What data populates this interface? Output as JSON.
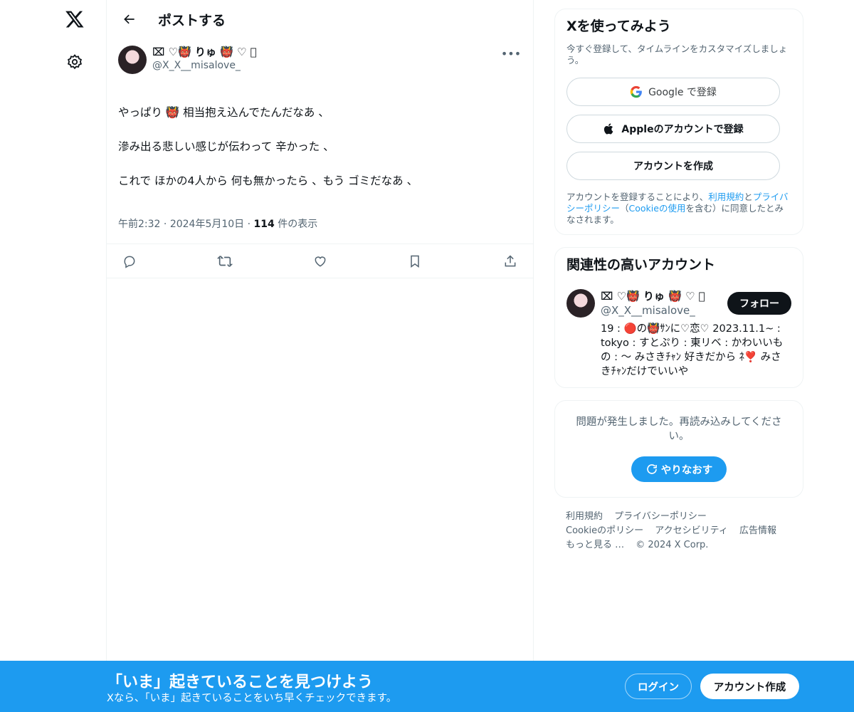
{
  "nav": {
    "logo_icon": "x-logo-icon",
    "settings_icon": "gear-icon"
  },
  "header": {
    "title": "ポストする"
  },
  "post": {
    "author_name": "⌧ ♡👹 りゅ 👹 ♡ ⃞",
    "author_handle": "@X_X__misalove_",
    "text_line1": "やっぱり 👹 相当抱え込んでたんだなあ 、",
    "text_line2": "滲み出る悲しい感じが伝わって 辛かった 、",
    "text_line3": "これで ほかの4人から 何も無かったら 、もう ゴミだなあ 、",
    "time": "午前2:32",
    "date": "2024年5月10日",
    "views_count": "114",
    "views_label": "件の表示"
  },
  "signup": {
    "title": "Xを使ってみよう",
    "subtitle": "今すぐ登録して、タイムラインをカスタマイズしましょう。",
    "google_label": "Google で登録",
    "apple_label": "Appleのアカウントで登録",
    "create_label": "アカウントを作成",
    "terms_pre": "アカウントを登録することにより、",
    "terms_link1": "利用規約",
    "terms_and": "と",
    "terms_link2": "プライバシーポリシー",
    "terms_mid": "（",
    "terms_link3": "Cookieの使用",
    "terms_post": "を含む）に同意したとみなされます。"
  },
  "related": {
    "title": "関連性の高いアカウント",
    "name": "⌧ ♡👹 りゅ 👹 ♡ ⃞",
    "handle": "@X_X__misalove_",
    "follow_label": "フォロー",
    "bio": "19 : 🔴の👹ｻﾝに♡恋♡ 2023.11.1~ : tokyo : すとぷり : 東リベ : かわいいもの : 〜 みさきﾁｬﾝ 好きだから ﾈ❣️ みさきﾁｬﾝだけでいいや"
  },
  "error": {
    "message": "問題が発生しました。再読み込みしてください。",
    "retry_label": "やりなおす"
  },
  "footer": {
    "terms": "利用規約",
    "privacy": "プライバシーポリシー",
    "cookie": "Cookieのポリシー",
    "accessibility": "アクセシビリティ",
    "ads": "広告情報",
    "more": "もっと見る …",
    "copyright": "© 2024 X Corp."
  },
  "banner": {
    "title": "「いま」起きていることを見つけよう",
    "subtitle": "Xなら、「いま」起きていることをいち早くチェックできます。",
    "login_label": "ログイン",
    "create_label": "アカウント作成"
  },
  "colors": {
    "accent": "#1d9bf0",
    "text": "#0f1419",
    "muted": "#536471",
    "border": "#eff3f4"
  }
}
